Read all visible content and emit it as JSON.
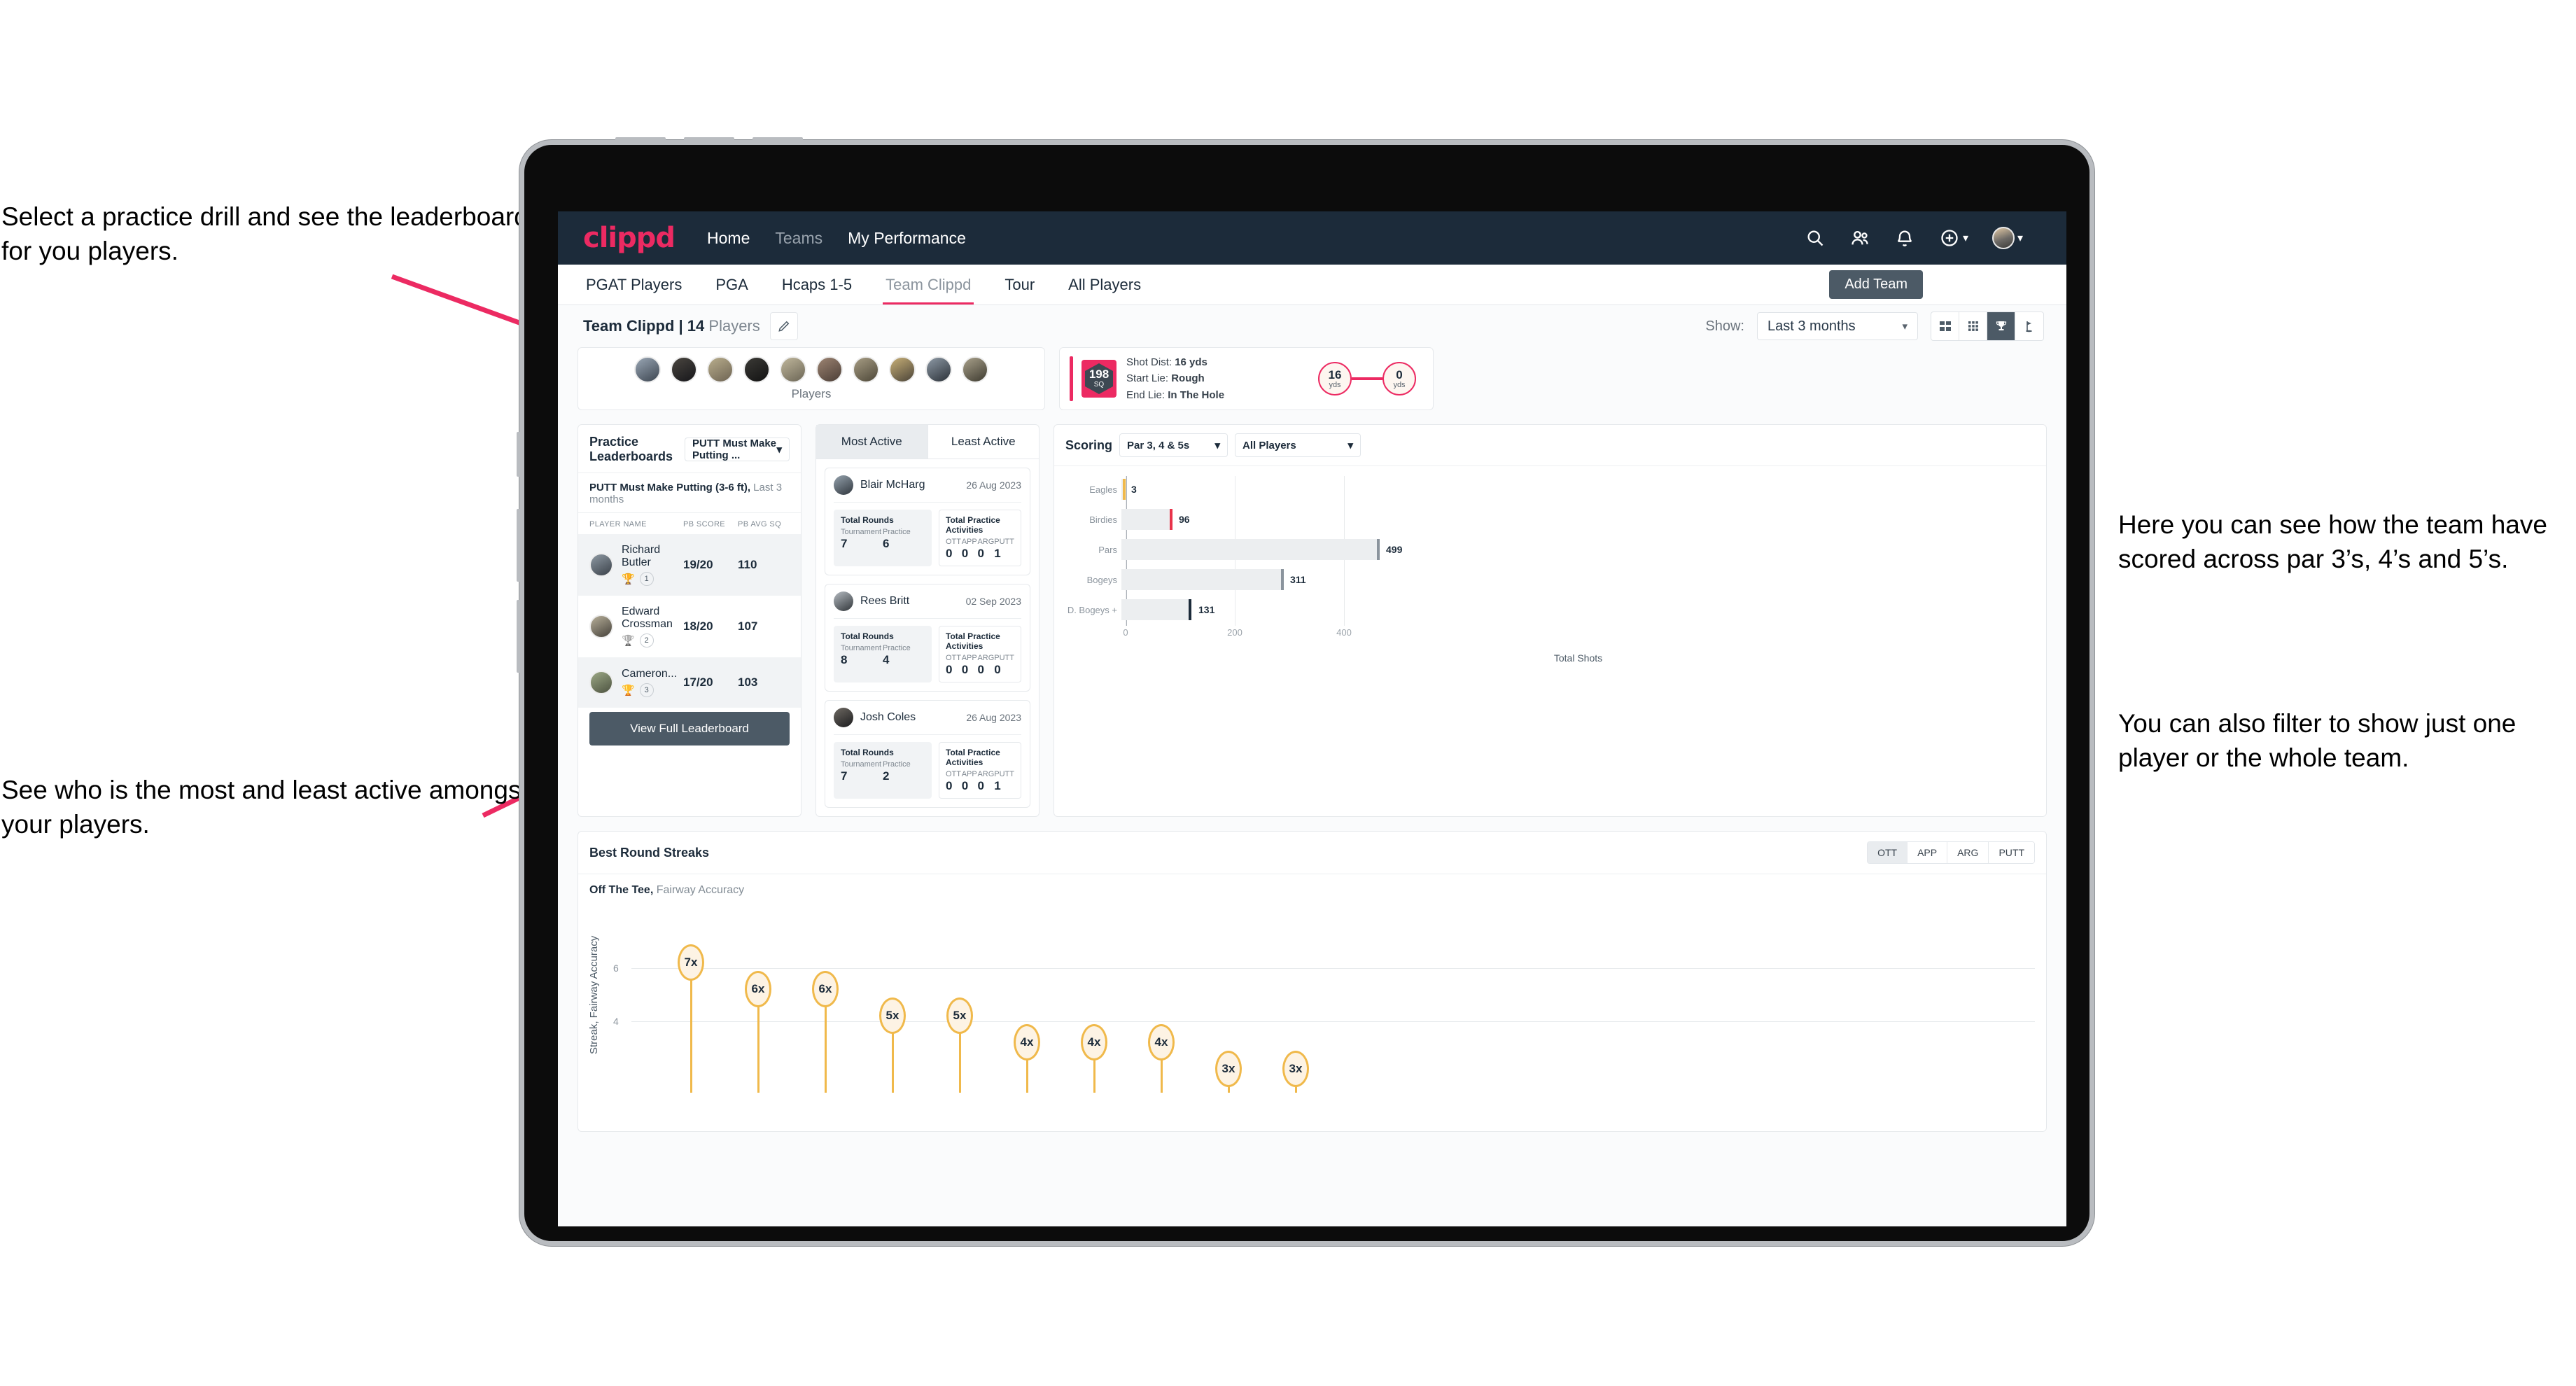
{
  "annotations": {
    "top_left": "Select a practice drill and see the leaderboard for you players.",
    "bottom_left": "See who is the most and least active amongst your players.",
    "right_1": "Here you can see how the team have scored across par 3’s, 4’s and 5’s.",
    "right_2": "You can also filter to show just one player or the whole team."
  },
  "colors": {
    "brand_pink": "#ec2a62",
    "nav_dark": "#1c2b3a",
    "button_slate": "#4c5a66",
    "streak_amber": "#f0b94b"
  },
  "topnav": {
    "brand": "clippd",
    "links": [
      {
        "label": "Home",
        "active": true
      },
      {
        "label": "Teams",
        "active": false
      },
      {
        "label": "My Performance",
        "active": true
      }
    ],
    "icons": [
      "search-icon",
      "people-icon",
      "bell-icon",
      "plus-circle-icon",
      "avatar"
    ]
  },
  "tabs": {
    "items": [
      {
        "label": "PGAT Players",
        "active": false
      },
      {
        "label": "PGA",
        "active": false
      },
      {
        "label": "Hcaps 1-5",
        "active": false
      },
      {
        "label": "Team Clippd",
        "active": true
      },
      {
        "label": "Tour",
        "active": false
      },
      {
        "label": "All Players",
        "active": false
      }
    ],
    "add_team": "Add Team"
  },
  "toolbar": {
    "team_name": "Team Clippd",
    "separator": "|",
    "player_count": "14",
    "players_word": "Players",
    "show_label": "Show:",
    "show_value": "Last 3 months",
    "view_modes": [
      "grid-large-icon",
      "grid-small-icon",
      "trophy-icon",
      "flag-icon"
    ],
    "active_view": "trophy-icon"
  },
  "players_strip": {
    "label": "Players",
    "avatar_count": 10
  },
  "shot_card": {
    "sq_value": "198",
    "sq_unit": "SQ",
    "lines": [
      {
        "key": "Shot Dist:",
        "value": "16 yds"
      },
      {
        "key": "Start Lie:",
        "value": "Rough"
      },
      {
        "key": "End Lie:",
        "value": "In The Hole"
      }
    ],
    "start_dist": "16",
    "start_unit": "yds",
    "end_dist": "0",
    "end_unit": "yds"
  },
  "practice_leaderboards": {
    "title": "Practice Leaderboards",
    "drill_selected": "PUTT Must Make Putting ...",
    "subtitle_bold": "PUTT Must Make Putting (3-6 ft),",
    "subtitle_dim": "Last 3 months",
    "columns": [
      "PLAYER NAME",
      "PB SCORE",
      "PB AVG SQ"
    ],
    "rows": [
      {
        "name": "Richard Butler",
        "rank": "1",
        "medal": "gold",
        "pb_score": "19/20",
        "pb_avg_sq": "110"
      },
      {
        "name": "Edward Crossman",
        "rank": "2",
        "medal": "silver",
        "pb_score": "18/20",
        "pb_avg_sq": "107"
      },
      {
        "name": "Cameron...",
        "rank": "3",
        "medal": "bronze",
        "pb_score": "17/20",
        "pb_avg_sq": "103"
      }
    ],
    "view_full": "View Full Leaderboard"
  },
  "activity": {
    "tabs": [
      {
        "label": "Most Active",
        "active": true
      },
      {
        "label": "Least Active",
        "active": false
      }
    ],
    "rounds_title": "Total Rounds",
    "rounds_keys": [
      "Tournament",
      "Practice"
    ],
    "practice_title": "Total Practice Activities",
    "practice_keys": [
      "OTT",
      "APP",
      "ARG",
      "PUTT"
    ],
    "items": [
      {
        "name": "Blair McHarg",
        "date": "26 Aug 2023",
        "tournament": "7",
        "practice": "6",
        "ott": "0",
        "app": "0",
        "arg": "0",
        "putt": "1"
      },
      {
        "name": "Rees Britt",
        "date": "02 Sep 2023",
        "tournament": "8",
        "practice": "4",
        "ott": "0",
        "app": "0",
        "arg": "0",
        "putt": "0"
      },
      {
        "name": "Josh Coles",
        "date": "26 Aug 2023",
        "tournament": "7",
        "practice": "2",
        "ott": "0",
        "app": "0",
        "arg": "0",
        "putt": "1"
      }
    ]
  },
  "scoring": {
    "title": "Scoring",
    "filter_par": "Par 3, 4 & 5s",
    "filter_players": "All Players"
  },
  "streaks": {
    "title": "Best Round Streaks",
    "toggle": [
      {
        "label": "OTT",
        "active": true
      },
      {
        "label": "APP",
        "active": false
      },
      {
        "label": "ARG",
        "active": false
      },
      {
        "label": "PUTT",
        "active": false
      }
    ],
    "sub_bold": "Off The Tee,",
    "sub_dim": "Fairway Accuracy"
  },
  "chart_data": [
    {
      "type": "bar",
      "orientation": "horizontal",
      "title": "Scoring",
      "categories": [
        "Eagles",
        "Birdies",
        "Pars",
        "Bogeys",
        "D. Bogeys +"
      ],
      "values": [
        3,
        96,
        499,
        311,
        131
      ],
      "bar_colors": [
        "#f0b94b",
        "#e8334a",
        "#8b949d",
        "#8b949d",
        "#1c2b3a"
      ],
      "xlabel": "Total Shots",
      "ylabel": "",
      "xlim": [
        0,
        540
      ],
      "xticks": [
        0,
        200,
        400
      ],
      "grid": true,
      "legend": "none"
    },
    {
      "type": "scatter",
      "title": "Best Round Streaks",
      "subtitle": "Off The Tee, Fairway Accuracy",
      "ylabel": "Streak, Fairway Accuracy",
      "values": [
        7,
        6,
        6,
        5,
        5,
        4,
        4,
        4,
        3,
        3
      ],
      "labels": [
        "7x",
        "6x",
        "6x",
        "5x",
        "5x",
        "4x",
        "4x",
        "4x",
        "3x",
        "3x"
      ],
      "yticks": [
        4,
        6
      ],
      "ylim": [
        0,
        8
      ],
      "marker_color": "#f0b94b",
      "grid": true
    }
  ]
}
